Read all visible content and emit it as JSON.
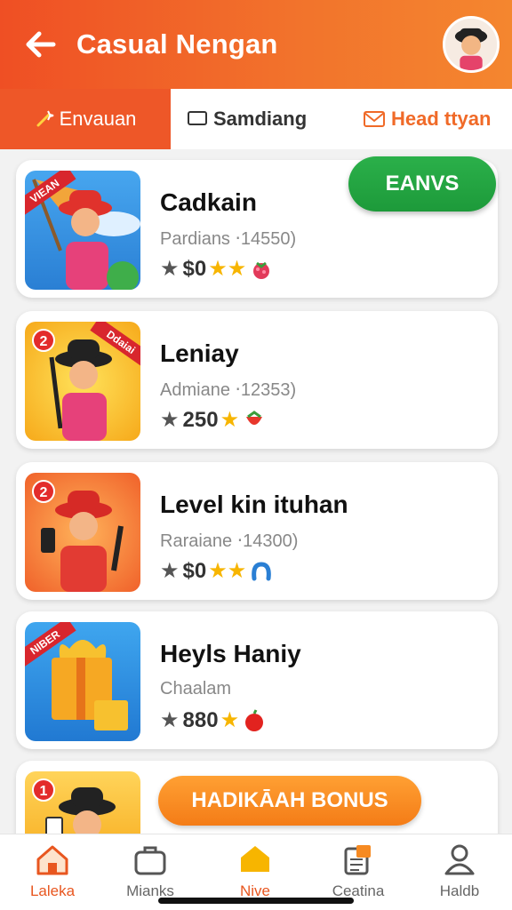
{
  "header": {
    "title": "Casual Nengan"
  },
  "tabs": [
    {
      "label": "Envauan"
    },
    {
      "label": "Samdiang"
    },
    {
      "label": "Head ttyan"
    }
  ],
  "games": [
    {
      "title": "Cadkain",
      "subtitle": "Pardians ‧14550)",
      "rating": "$0",
      "ribbon": "VIEAN"
    },
    {
      "title": "Leniay",
      "subtitle": "Admiane ‧12353)",
      "rating": "250",
      "badge": "2",
      "ribbon": "Ddaiai"
    },
    {
      "title": "Level kin ituhan",
      "subtitle": "Raraiane ‧14300)",
      "rating": "$0",
      "badge": "2"
    },
    {
      "title": "Heyls Haniy",
      "subtitle": "Chaalam",
      "rating": "880",
      "ribbon": "NIBER"
    },
    {
      "badge": "1"
    }
  ],
  "buttons": {
    "green": "EANVS",
    "bonus": "HADIKĀAH BONUS"
  },
  "nav": [
    {
      "label": "Laleka"
    },
    {
      "label": "Mianks"
    },
    {
      "label": "Nive"
    },
    {
      "label": "Ceatina"
    },
    {
      "label": "Haldb"
    }
  ],
  "colors": {
    "accent": "#ee5728",
    "green": "#22a440",
    "bonus": "#f68a22"
  }
}
